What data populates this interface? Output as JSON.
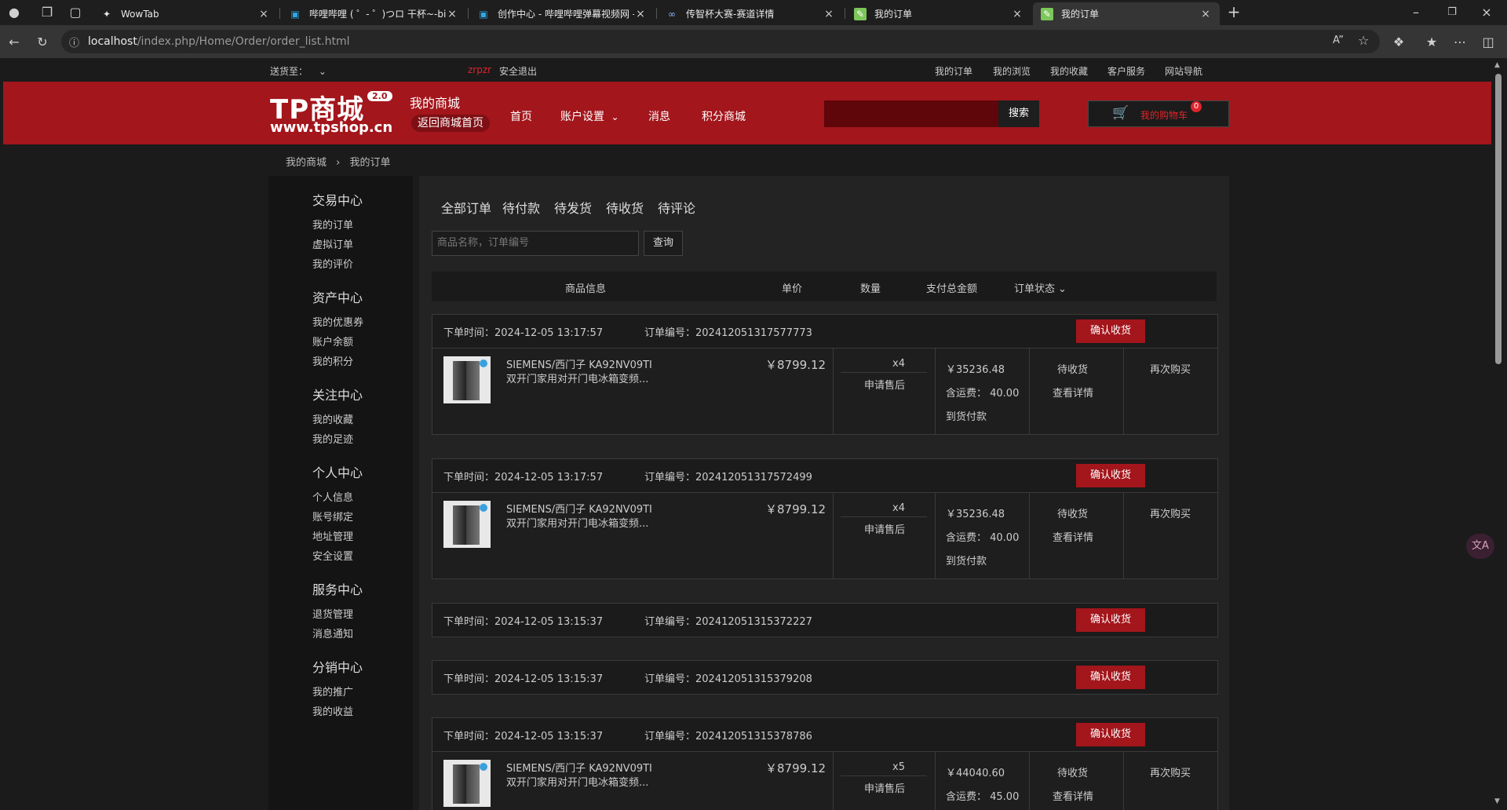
{
  "browser": {
    "tabs": [
      {
        "title": "WowTab",
        "icon": "wowtab-icon"
      },
      {
        "title": "哔哩哔哩 ( ゜- ゜)つロ 干杯~-bilibili",
        "icon": "bilibili-icon"
      },
      {
        "title": "创作中心 - 哔哩哔哩弹幕视频网 -",
        "icon": "bilibili-icon"
      },
      {
        "title": "传智杯大赛-赛道详情",
        "icon": "link-icon"
      },
      {
        "title": "我的订单",
        "icon": "tpshop-icon"
      },
      {
        "title": "我的订单",
        "icon": "tpshop-icon"
      }
    ],
    "url_host": "localhost",
    "url_path": "/index.php/Home/Order/order_list.html"
  },
  "topbar": {
    "ship_to": "送货至：",
    "username": "zrpzr",
    "logout": "安全退出",
    "links": [
      "我的订单",
      "我的浏览",
      "我的收藏",
      "客户服务",
      "网站导航"
    ]
  },
  "header": {
    "logo": "TP商城",
    "logo_version": "2.0",
    "logo_url": "www.tpshop.cn",
    "my_shop": "我的商城",
    "back_home": "返回商城首页",
    "nav": [
      "首页",
      "账户设置",
      "消息",
      "积分商城"
    ],
    "search_btn": "搜索",
    "cart_label": "我的购物车",
    "cart_count": "0"
  },
  "breadcrumb": {
    "home": "我的商城",
    "current": "我的订单"
  },
  "sidebar": [
    {
      "title": "交易中心",
      "items": [
        "我的订单",
        "虚拟订单",
        "我的评价"
      ]
    },
    {
      "title": "资产中心",
      "items": [
        "我的优惠券",
        "账户余额",
        "我的积分"
      ]
    },
    {
      "title": "关注中心",
      "items": [
        "我的收藏",
        "我的足迹"
      ]
    },
    {
      "title": "个人中心",
      "items": [
        "个人信息",
        "账号绑定",
        "地址管理",
        "安全设置"
      ]
    },
    {
      "title": "服务中心",
      "items": [
        "退货管理",
        "消息通知"
      ]
    },
    {
      "title": "分销中心",
      "items": [
        "我的推广",
        "我的收益"
      ]
    }
  ],
  "main": {
    "tabs": [
      "全部订单",
      "待付款",
      "待发货",
      "待收货",
      "待评论"
    ],
    "search_placeholder": "商品名称，订单编号",
    "search_btn": "查询",
    "columns": [
      "商品信息",
      "单价",
      "数量",
      "支付总金额",
      "订单状态"
    ],
    "orders": [
      {
        "time_label": "下单时间：",
        "time": "2024-12-05 13:17:57",
        "no_label": "订单编号：",
        "no": "202412051317577773",
        "confirm": "确认收货",
        "name1": "SIEMENS/西门子 KA92NV09TI",
        "name2": "双开门家用对开门电冰箱变频...",
        "price": "￥8799.12",
        "qty": "x4",
        "after_sale": "申请售后",
        "total": "￥35236.48",
        "ship": "含运费：  40.00",
        "cod": "到货付款",
        "status": "待收货",
        "detail": "查看详情",
        "rebuy": "再次购买"
      },
      {
        "time_label": "下单时间：",
        "time": "2024-12-05 13:17:57",
        "no_label": "订单编号：",
        "no": "202412051317572499",
        "confirm": "确认收货",
        "name1": "SIEMENS/西门子 KA92NV09TI",
        "name2": "双开门家用对开门电冰箱变频...",
        "price": "￥8799.12",
        "qty": "x4",
        "after_sale": "申请售后",
        "total": "￥35236.48",
        "ship": "含运费：  40.00",
        "cod": "到货付款",
        "status": "待收货",
        "detail": "查看详情",
        "rebuy": "再次购买"
      },
      {
        "time_label": "下单时间：",
        "time": "2024-12-05 13:15:37",
        "no_label": "订单编号：",
        "no": "202412051315372227",
        "confirm": "确认收货"
      },
      {
        "time_label": "下单时间：",
        "time": "2024-12-05 13:15:37",
        "no_label": "订单编号：",
        "no": "202412051315379208",
        "confirm": "确认收货"
      },
      {
        "time_label": "下单时间：",
        "time": "2024-12-05 13:15:37",
        "no_label": "订单编号：",
        "no": "202412051315378786",
        "confirm": "确认收货",
        "name1": "SIEMENS/西门子 KA92NV09TI",
        "name2": "双开门家用对开门电冰箱变频...",
        "price": "￥8799.12",
        "qty": "x5",
        "after_sale": "申请售后",
        "total": "￥44040.60",
        "ship": "含运费：  45.00",
        "status": "待收货",
        "detail": "查看详情",
        "rebuy": "再次购买"
      }
    ]
  },
  "translate_btn": "文A",
  "colors": {
    "brand_red": "#a3161c",
    "bg": "#1b1b1b"
  }
}
